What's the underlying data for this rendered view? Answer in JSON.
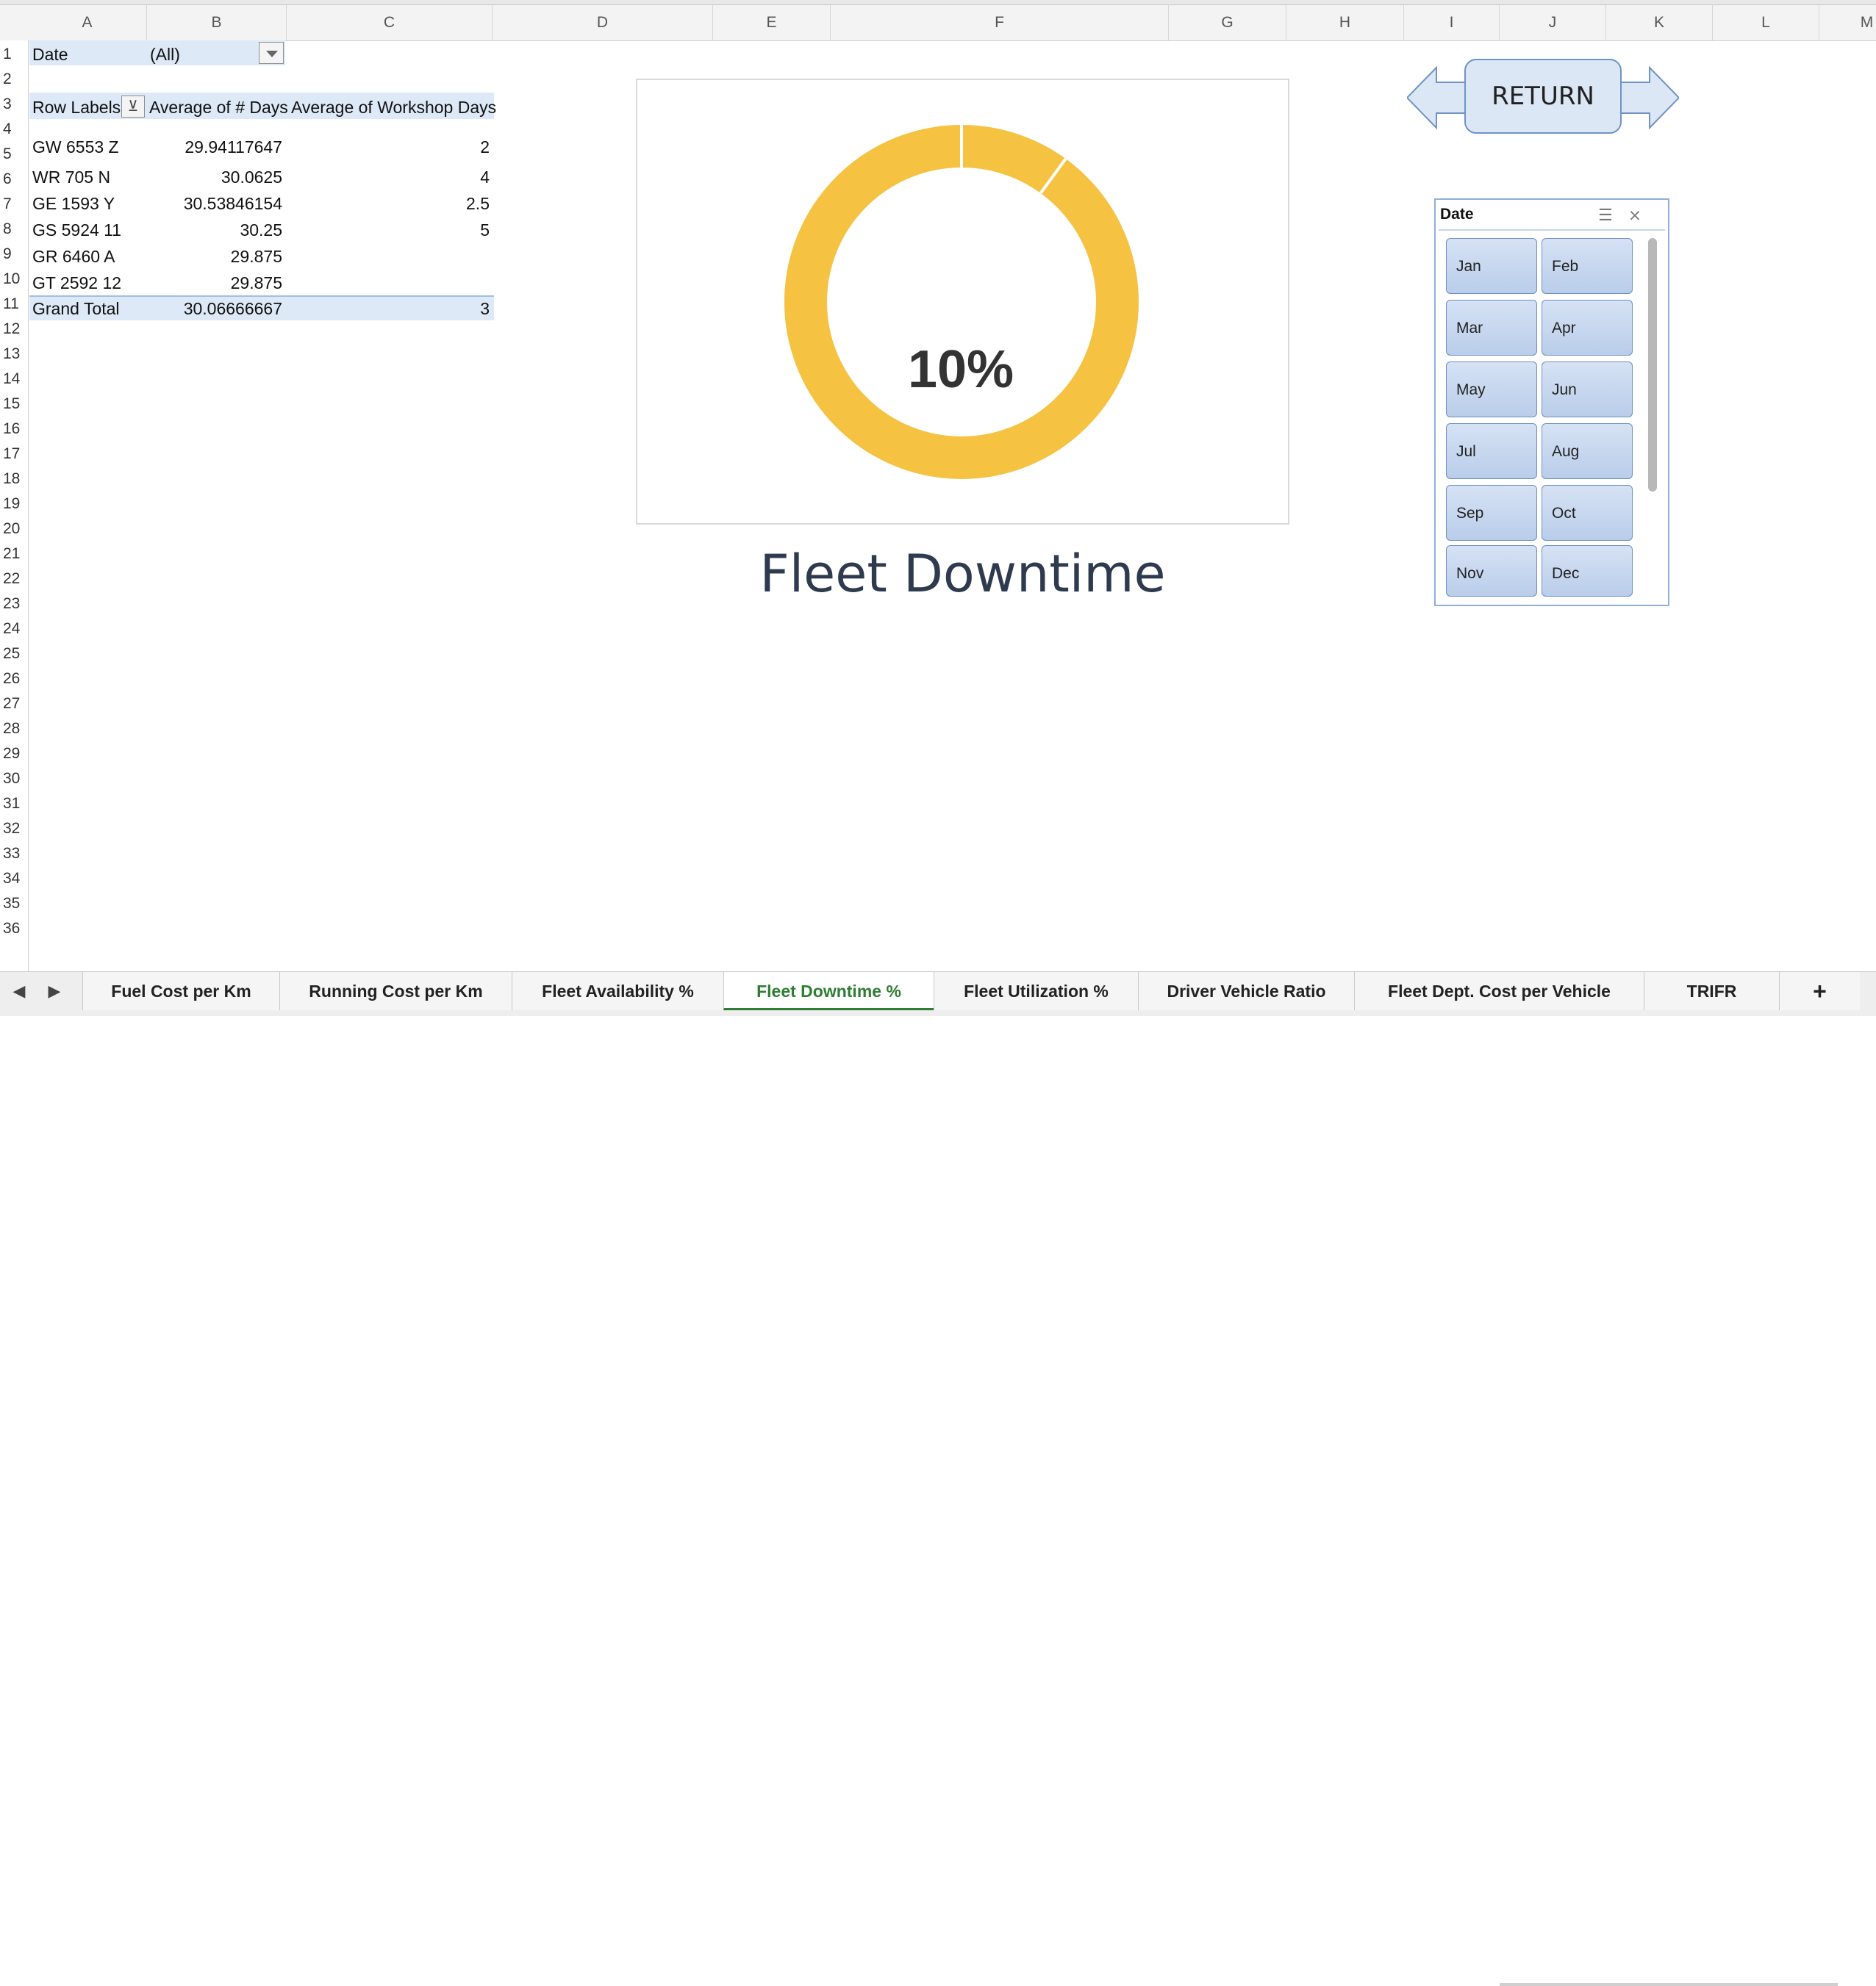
{
  "columns": [
    "A",
    "B",
    "C",
    "D",
    "E",
    "F",
    "G",
    "H",
    "I",
    "J",
    "K",
    "L",
    "M"
  ],
  "rows": [
    "1",
    "2",
    "3",
    "4",
    "5",
    "6",
    "7",
    "8",
    "9",
    "10",
    "11",
    "12",
    "13",
    "14",
    "15",
    "16",
    "17",
    "18",
    "19",
    "20",
    "21",
    "22",
    "23",
    "24",
    "25",
    "26",
    "27",
    "28",
    "29",
    "30",
    "31",
    "32",
    "33",
    "34",
    "35",
    "36"
  ],
  "pivot": {
    "filter_label": "Date",
    "filter_value": "(All)",
    "headers": [
      "Row Labels",
      "Average of # Days",
      "Average of Workshop Days"
    ],
    "rows": [
      {
        "label": "GW 6553 Z",
        "avg_days": "29.94117647",
        "workshop_days": "2"
      },
      {
        "label": "WR 705 N",
        "avg_days": "30.0625",
        "workshop_days": "4"
      },
      {
        "label": "GE 1593 Y",
        "avg_days": "30.53846154",
        "workshop_days": "2.5"
      },
      {
        "label": "GS 5924 11",
        "avg_days": "30.25",
        "workshop_days": "5"
      },
      {
        "label": "GR 6460 A",
        "avg_days": "29.875",
        "workshop_days": ""
      },
      {
        "label": "GT 2592 12",
        "avg_days": "29.875",
        "workshop_days": ""
      }
    ],
    "total": {
      "label": "Grand Total",
      "avg_days": "30.06666667",
      "workshop_days": "3"
    }
  },
  "chart": {
    "center_label": "10%",
    "title": "Fleet Downtime",
    "colors": {
      "ring": "#f5c242",
      "track_gap": "#ffffff",
      "label": "#333333"
    }
  },
  "chart_data": {
    "type": "pie",
    "style": "doughnut",
    "slices": [
      {
        "value": 0.1
      },
      {
        "value": 0.9
      }
    ]
  },
  "return_button": {
    "label": "RETURN"
  },
  "slicer": {
    "title": "Date",
    "items": [
      "Jan",
      "Feb",
      "Mar",
      "Apr",
      "May",
      "Jun",
      "Jul",
      "Aug",
      "Sep",
      "Oct",
      "Nov",
      "Dec"
    ],
    "icons": [
      "multi-select-icon",
      "clear-filter-icon"
    ]
  },
  "tabs": {
    "items": [
      "Fuel Cost per Km",
      "Running Cost per Km",
      "Fleet Availability %",
      "Fleet Downtime %",
      "Fleet Utilization %",
      "Driver Vehicle Ratio",
      "Fleet Dept. Cost per Vehicle",
      "TRIFR"
    ],
    "active": "Fleet Downtime %",
    "add_label": "+"
  }
}
